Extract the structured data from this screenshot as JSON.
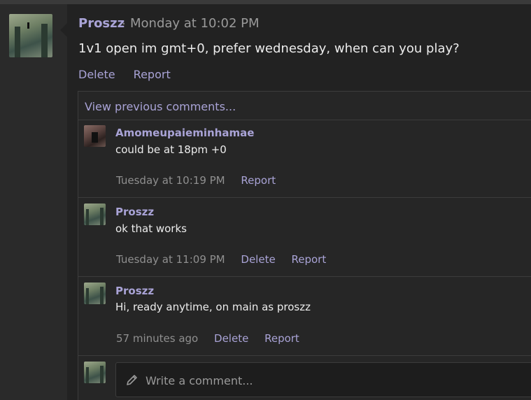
{
  "post": {
    "author": "Proszz",
    "separator": "·",
    "time": "Monday at 10:02 PM",
    "body": "1v1 open im gmt+0, prefer wednesday, when can you play?",
    "actions": {
      "delete": "Delete",
      "report": "Report"
    }
  },
  "comments": {
    "view_previous": "View previous comments...",
    "items": [
      {
        "author": "Amomeupaieminhamae",
        "text": "could be at 18pm +0",
        "time": "Tuesday at 10:19 PM",
        "report": "Report"
      },
      {
        "author": "Proszz",
        "text": "ok that works",
        "time": "Tuesday at 11:09 PM",
        "delete": "Delete",
        "report": "Report"
      },
      {
        "author": "Proszz",
        "text": "Hi, ready anytime, on main as proszz",
        "time": "57 minutes ago",
        "delete": "Delete",
        "report": "Report"
      }
    ],
    "composer": {
      "placeholder": "Write a comment...",
      "icon": "pencil-icon"
    }
  },
  "colors": {
    "accent": "#a9a3d6",
    "background": "#222222",
    "text": "#ececec",
    "muted": "#8f8f8f"
  }
}
